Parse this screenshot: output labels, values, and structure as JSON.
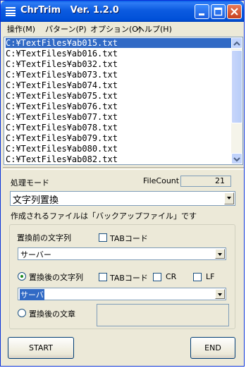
{
  "window": {
    "title": "ChrTrim   Ver. 1.2.0"
  },
  "menu": {
    "items": [
      "操作(M)",
      "パターン(P)",
      "オプション(O)",
      "ヘルプ(H)"
    ]
  },
  "file_list": {
    "items": [
      "C:¥TextFiles¥ab015.txt",
      "C:¥TextFiles¥ab016.txt",
      "C:¥TextFiles¥ab032.txt",
      "C:¥TextFiles¥ab073.txt",
      "C:¥TextFiles¥ab074.txt",
      "C:¥TextFiles¥ab075.txt",
      "C:¥TextFiles¥ab076.txt",
      "C:¥TextFiles¥ab077.txt",
      "C:¥TextFiles¥ab078.txt",
      "C:¥TextFiles¥ab079.txt",
      "C:¥TextFiles¥ab080.txt",
      "C:¥TextFiles¥ab082.txt"
    ],
    "selected_index": 0
  },
  "mode": {
    "label": "処理モード",
    "value": "文字列置換"
  },
  "file_count": {
    "label": "FileCount",
    "value": "21"
  },
  "note": "作成されるファイルは「バックアップファイル」です",
  "before": {
    "label": "置換前の文字列",
    "tab_code_label": "TABコード",
    "value": "サーバー"
  },
  "after_string": {
    "label": "置換後の文字列",
    "tab_code_label": "TABコード",
    "cr_label": "CR",
    "lf_label": "LF",
    "value": "サーバ"
  },
  "after_sentence": {
    "label": "置換後の文章"
  },
  "buttons": {
    "start": "START",
    "end": "END"
  },
  "colors": {
    "selection": "#316ac5",
    "titlebar": "#0054e3",
    "face": "#ece9d8"
  }
}
